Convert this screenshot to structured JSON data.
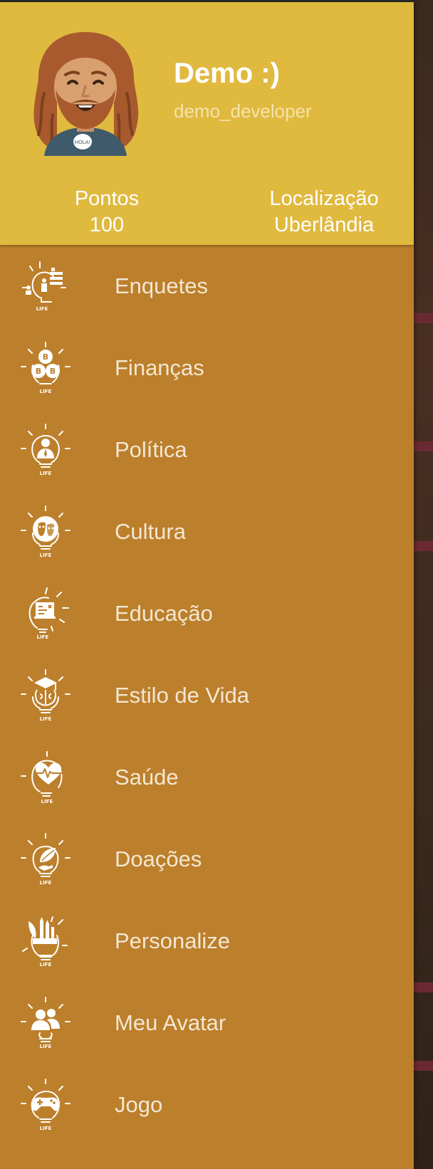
{
  "profile": {
    "name": "Demo :)",
    "username": "demo_developer",
    "avatar_badge": "HOLA!"
  },
  "stats": {
    "points_label": "Pontos",
    "points_value": "100",
    "location_label": "Localização",
    "location_value": "Uberlândia"
  },
  "menu": [
    {
      "label": "Enquetes",
      "icon": "poll-bulb-icon"
    },
    {
      "label": "Finanças",
      "icon": "bitcoin-bulb-icon"
    },
    {
      "label": "Política",
      "icon": "politician-bulb-icon"
    },
    {
      "label": "Cultura",
      "icon": "theater-masks-bulb-icon"
    },
    {
      "label": "Educação",
      "icon": "chalkboard-bulb-icon"
    },
    {
      "label": "Estilo de Vida",
      "icon": "graduation-brain-bulb-icon"
    },
    {
      "label": "Saúde",
      "icon": "heartbeat-bulb-icon"
    },
    {
      "label": "Doações",
      "icon": "hand-leaf-bulb-icon"
    },
    {
      "label": "Personalize",
      "icon": "pencils-bulb-icon"
    },
    {
      "label": "Meu Avatar",
      "icon": "users-bulb-icon"
    },
    {
      "label": "Jogo",
      "icon": "gamepad-bulb-icon"
    }
  ],
  "icon_caption": "LIFE",
  "colors": {
    "header_bg": "#e0b93f",
    "drawer_bg": "#bc7f2b",
    "label_text": "#f3e7d3",
    "username_text": "#f4e4ad"
  }
}
